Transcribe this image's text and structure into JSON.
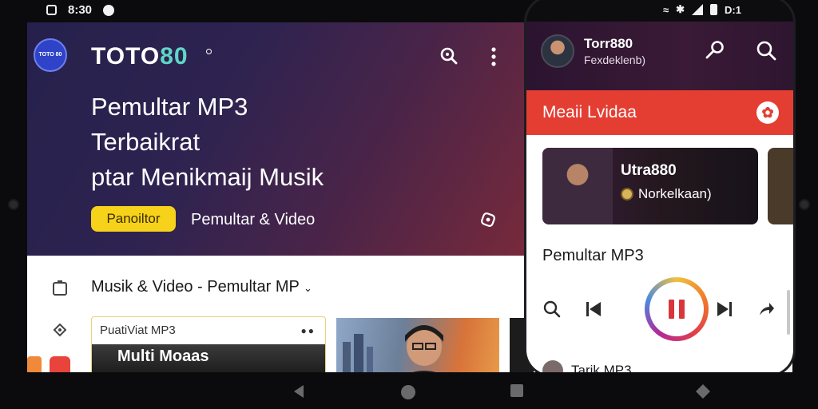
{
  "status_bar": {
    "time": "8:30",
    "battery": "D:1"
  },
  "header": {
    "logo_badge_text": "TOTO 80",
    "brand_primary": "TOTO",
    "brand_accent": "80",
    "icons": [
      "search-icon",
      "more-vert-icon"
    ]
  },
  "hero": {
    "title_line1": "Pemultar MP3",
    "title_line2": "Terbaikrat",
    "title_line3": "ptar Menikmaij Musik",
    "pill_label": "Panoiltor",
    "pill_sub": "Pemultar & Video",
    "side_icon": "settings-icon"
  },
  "section": {
    "title": "Musik & Video - Pemultar MP",
    "card1_label": "PuatiViat MP3",
    "card1_strip_text": "Multi Moaas",
    "card1_dots": "●●"
  },
  "phone": {
    "user_name": "Torr880",
    "user_sub": "Fexdeklenb)",
    "header_icons": [
      "key-icon",
      "search-icon"
    ],
    "banner_title": "Meaii Lvidaa",
    "card_title": "Utra880",
    "card_sub": "Norkelkaan)",
    "now_playing_title": "Pemultar MP3",
    "bottom_item": "Tarik MP3"
  },
  "colors": {
    "hero_start": "#25214c",
    "hero_end": "#7a2a3a",
    "brand_accent": "#5fd7c7",
    "pill": "#f6d21a",
    "phone_banner": "#e43e33",
    "play_pause": "#d8363c"
  }
}
